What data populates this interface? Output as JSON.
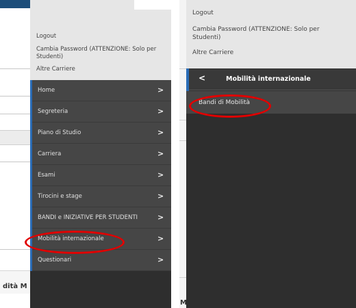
{
  "user_menu": {
    "logout": "Logout",
    "change_password_line1": "Cambia Password (ATTENZIONE: Solo per",
    "change_password_line2": "Studenti)",
    "other_careers": "Altre Carriere"
  },
  "main_menu": [
    {
      "label": "Home"
    },
    {
      "label": "Segreteria"
    },
    {
      "label": "Piano di Studio"
    },
    {
      "label": "Carriera"
    },
    {
      "label": "Esami"
    },
    {
      "label": "Tirocini e stage"
    },
    {
      "label": "BANDI e INIZIATIVE PER STUDENTI"
    },
    {
      "label": "Mobilità internazionale"
    },
    {
      "label": "Questionari"
    }
  ],
  "chevron": ">",
  "back_chevron": "<",
  "submenu": {
    "title": "Mobilità internazionale",
    "items": [
      {
        "label": "Bandi di Mobilità"
      }
    ]
  },
  "background_fragment": "dità M",
  "background_fragment_right": "M",
  "annotation_color": "#e10000",
  "accent_color": "#2a6cb6"
}
